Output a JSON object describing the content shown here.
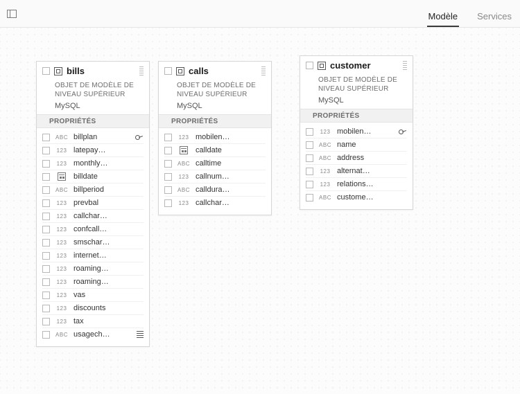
{
  "tabs": {
    "model": "Modèle",
    "services": "Services"
  },
  "labels": {
    "subtitle": "OBJET DE MODÈLE DE NIVEAU SUPÉRIEUR",
    "source": "MySQL",
    "section": "PROPRIÉTÉS"
  },
  "panels": {
    "bills": {
      "title": "bills",
      "props": [
        {
          "name": "billplan",
          "type": "abc",
          "key": true
        },
        {
          "name": "latepay…",
          "type": "123"
        },
        {
          "name": "monthly…",
          "type": "123"
        },
        {
          "name": "billdate",
          "type": "date"
        },
        {
          "name": "billperiod",
          "type": "abc"
        },
        {
          "name": "prevbal",
          "type": "123"
        },
        {
          "name": "callchar…",
          "type": "123"
        },
        {
          "name": "confcall…",
          "type": "123"
        },
        {
          "name": "smschar…",
          "type": "123"
        },
        {
          "name": "internet…",
          "type": "123"
        },
        {
          "name": "roaming…",
          "type": "123"
        },
        {
          "name": "roaming…",
          "type": "123"
        },
        {
          "name": "vas",
          "type": "123"
        },
        {
          "name": "discounts",
          "type": "123"
        },
        {
          "name": "tax",
          "type": "123"
        },
        {
          "name": "usagech…",
          "type": "abc",
          "list": true
        }
      ]
    },
    "calls": {
      "title": "calls",
      "props": [
        {
          "name": "mobilen…",
          "type": "123"
        },
        {
          "name": "calldate",
          "type": "date"
        },
        {
          "name": "calltime",
          "type": "abc"
        },
        {
          "name": "callnum…",
          "type": "123"
        },
        {
          "name": "calldura…",
          "type": "abc"
        },
        {
          "name": "callchar…",
          "type": "123"
        }
      ]
    },
    "customer": {
      "title": "customer",
      "props": [
        {
          "name": "mobilen…",
          "type": "123",
          "key": true
        },
        {
          "name": "name",
          "type": "abc"
        },
        {
          "name": "address",
          "type": "abc"
        },
        {
          "name": "alternat…",
          "type": "123"
        },
        {
          "name": "relations…",
          "type": "123"
        },
        {
          "name": "custome…",
          "type": "abc"
        }
      ]
    }
  }
}
